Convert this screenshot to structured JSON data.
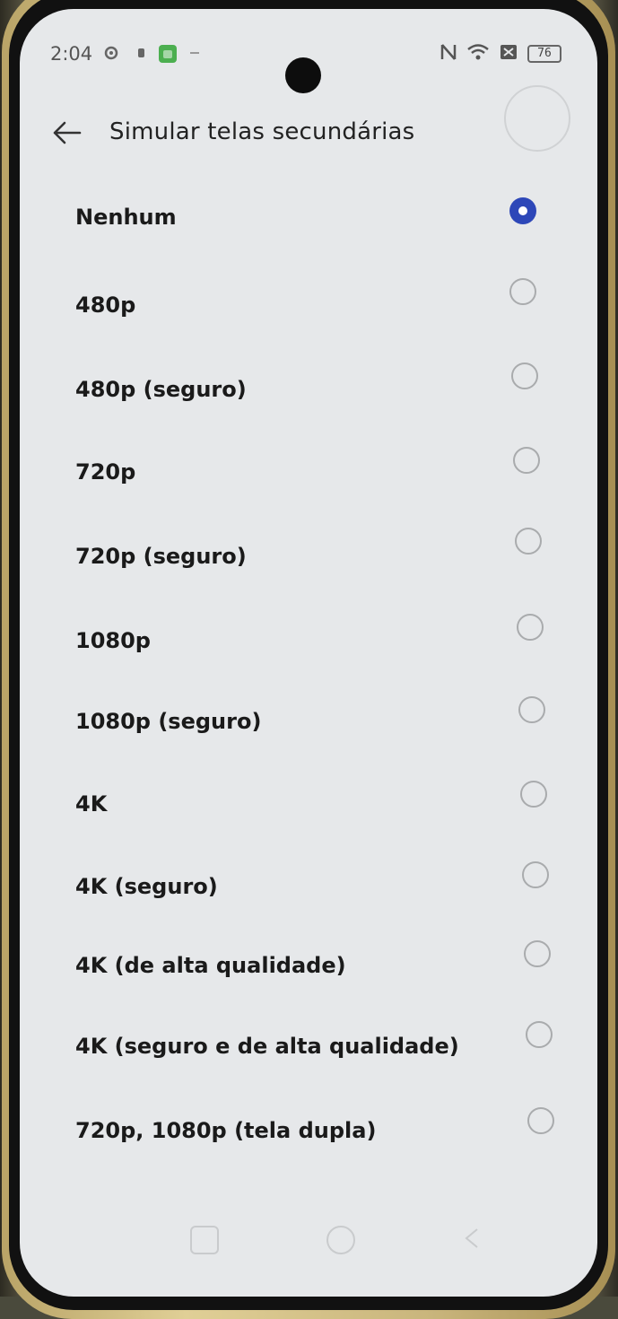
{
  "status_bar": {
    "time": "2:04",
    "battery": "76",
    "icons": [
      "settings-gear-icon",
      "notification-icon",
      "android-app-icon",
      "dash-icon",
      "nfc-icon",
      "wifi-icon",
      "sim-off-icon",
      "battery-icon"
    ]
  },
  "header": {
    "back_icon": "arrow-left-icon",
    "title": "Simular telas secundárias"
  },
  "options": [
    {
      "label": "Nenhum",
      "selected": true
    },
    {
      "label": "480p",
      "selected": false
    },
    {
      "label": "480p (seguro)",
      "selected": false
    },
    {
      "label": "720p",
      "selected": false
    },
    {
      "label": "720p (seguro)",
      "selected": false
    },
    {
      "label": "1080p",
      "selected": false
    },
    {
      "label": "1080p (seguro)",
      "selected": false
    },
    {
      "label": "4K",
      "selected": false
    },
    {
      "label": "4K (seguro)",
      "selected": false
    },
    {
      "label": "4K (de alta qualidade)",
      "selected": false
    },
    {
      "label": "4K (seguro e de alta qualidade)",
      "selected": false
    },
    {
      "label": "720p, 1080p (tela dupla)",
      "selected": false
    }
  ],
  "nav_bar": {
    "buttons": [
      "recents-icon",
      "home-icon",
      "back-icon"
    ]
  },
  "colors": {
    "accent": "#2d47b8",
    "background": "#e6e8ea",
    "text": "#1a1a1a"
  }
}
